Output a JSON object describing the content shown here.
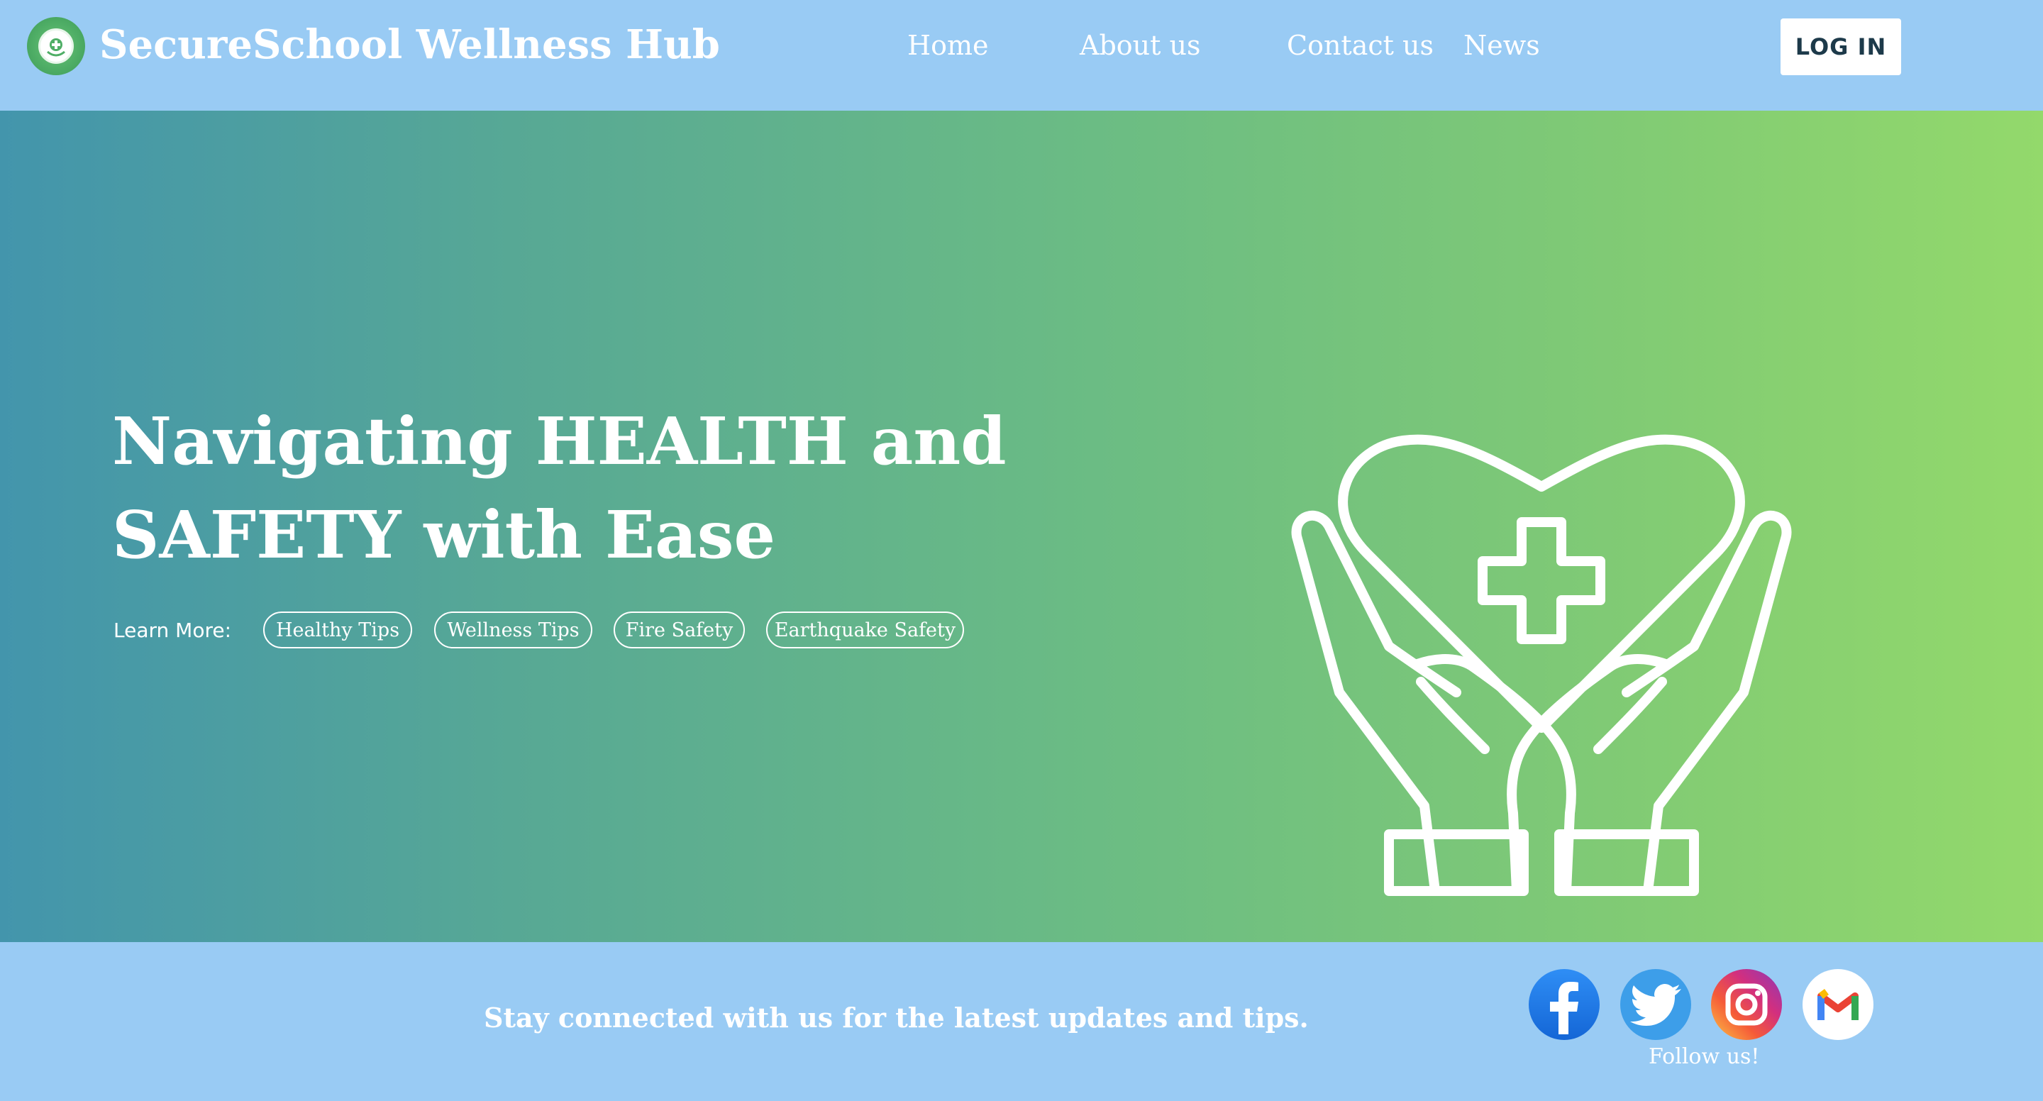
{
  "header": {
    "brand": "SecureSchool Wellness Hub",
    "nav": [
      "Home",
      "About us",
      "Contact us",
      "News"
    ],
    "login_label": "LOG IN"
  },
  "hero": {
    "title_line1": "Navigating HEALTH and",
    "title_line2": "SAFETY with Ease",
    "learn_more_label": "Learn More:",
    "tags": [
      "Healthy Tips",
      "Wellness Tips",
      "Fire Safety",
      "Earthquake Safety"
    ],
    "icon": "heart-cross-hands-icon"
  },
  "footer": {
    "tagline": "Stay connected with us for the latest updates and tips.",
    "follow_label": "Follow us!",
    "social_icons": [
      "facebook-icon",
      "twitter-icon",
      "instagram-icon",
      "gmail-icon"
    ]
  },
  "colors": {
    "header_bg": "#99cbf4",
    "hero_gradient_start": "#4395ac",
    "hero_gradient_end": "#93d96b",
    "text": "#ffffff",
    "login_text": "#1d3a4a"
  }
}
